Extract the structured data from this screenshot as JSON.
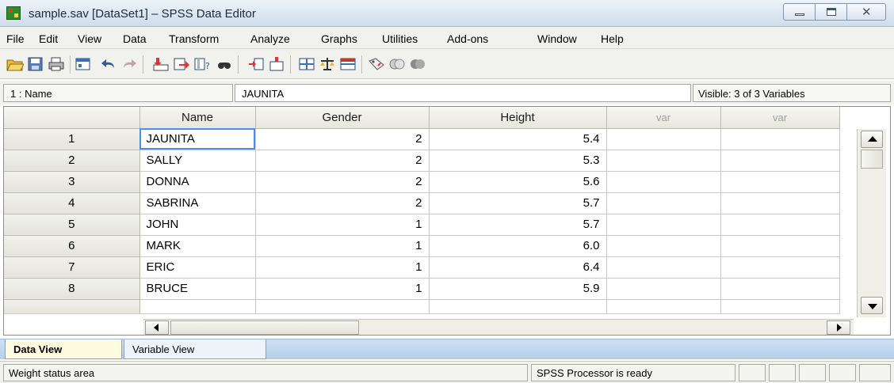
{
  "window": {
    "title": "sample.sav [DataSet1] – SPSS Data Editor",
    "controls": {
      "minimize": "minimize-icon",
      "maximize": "maximize-icon",
      "close": "✕"
    }
  },
  "menu": [
    "File",
    "Edit",
    "View",
    "Data",
    "Transform",
    "Analyze",
    "Graphs",
    "Utilities",
    "Add-ons",
    "Window",
    "Help"
  ],
  "toolbar": {
    "icons": [
      "open-folder-icon",
      "save-icon",
      "print-icon",
      "dialog-recall-icon",
      "undo-icon",
      "redo-icon",
      "goto-case-icon",
      "goto-variable-icon",
      "variables-info-icon",
      "find-icon",
      "insert-cases-icon",
      "insert-variable-icon",
      "split-file-icon",
      "weight-cases-icon",
      "select-cases-icon",
      "value-labels-icon",
      "use-sets-icon",
      "show-all-variables-icon"
    ]
  },
  "cell_editor": {
    "reference": "1 : Name",
    "value": "JAUNITA",
    "visible": "Visible: 3 of 3 Variables"
  },
  "grid": {
    "columns": [
      "Name",
      "Gender",
      "Height",
      "var",
      "var"
    ],
    "rows": [
      {
        "num": "1",
        "name": "JAUNITA",
        "gender": "2",
        "height": "5.4"
      },
      {
        "num": "2",
        "name": "SALLY",
        "gender": "2",
        "height": "5.3"
      },
      {
        "num": "3",
        "name": "DONNA",
        "gender": "2",
        "height": "5.6"
      },
      {
        "num": "4",
        "name": "SABRINA",
        "gender": "2",
        "height": "5.7"
      },
      {
        "num": "5",
        "name": "JOHN",
        "gender": "1",
        "height": "5.7"
      },
      {
        "num": "6",
        "name": "MARK",
        "gender": "1",
        "height": "6.0"
      },
      {
        "num": "7",
        "name": "ERIC",
        "gender": "1",
        "height": "6.4"
      },
      {
        "num": "8",
        "name": "BRUCE",
        "gender": "1",
        "height": "5.9"
      }
    ]
  },
  "tabs": {
    "data_view": "Data View",
    "variable_view": "Variable View"
  },
  "status": {
    "weight": "Weight status area",
    "processor": "SPSS  Processor is ready"
  },
  "colors": {
    "selection": "#4d8ee8",
    "title_bar": "#dbe6f1",
    "tab_strip": "#b6cfea",
    "active_tab": "#fffbe0"
  }
}
